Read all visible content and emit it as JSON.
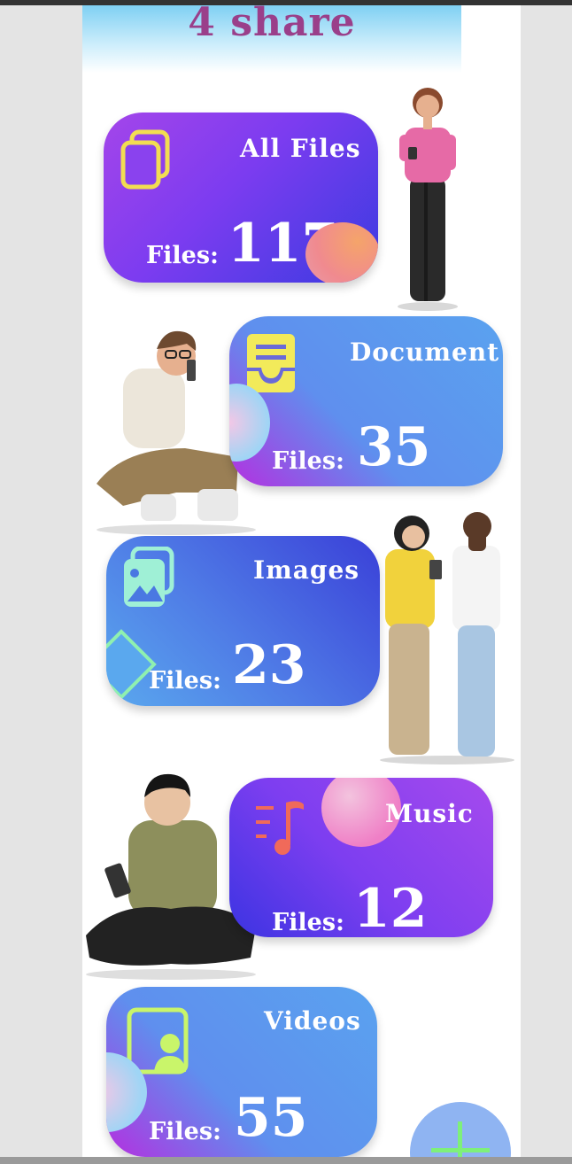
{
  "app": {
    "title": "4 share"
  },
  "cards": [
    {
      "title": "All Files",
      "files_label": "Files:",
      "count": "117",
      "icon": "files-stack-icon"
    },
    {
      "title": "Document",
      "files_label": "Files:",
      "count": "35",
      "icon": "document-tray-icon"
    },
    {
      "title": "Images",
      "files_label": "Files:",
      "count": "23",
      "icon": "image-stack-icon"
    },
    {
      "title": "Music",
      "files_label": "Files:",
      "count": "12",
      "icon": "music-list-icon"
    },
    {
      "title": "Videos",
      "files_label": "Files:",
      "count": "55",
      "icon": "video-person-icon"
    }
  ],
  "fab": {
    "icon": "plus-icon"
  },
  "colors": {
    "title": "#9a3f8a",
    "icon_yellow": "#f2dd52",
    "icon_mint": "#9ff0d6",
    "icon_coral": "#f06a5a",
    "icon_lime": "#c9f56a",
    "fab": "#8fb4f2"
  }
}
